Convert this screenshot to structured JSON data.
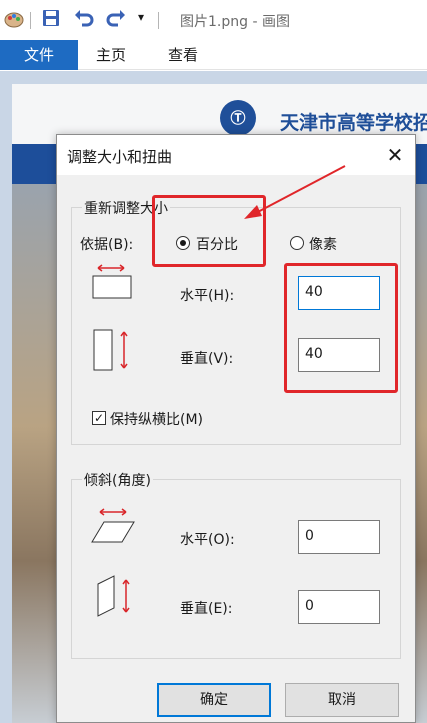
{
  "window": {
    "title": "图片1.png - 画图"
  },
  "ribbon": {
    "file_tab": "文件",
    "tabs": [
      "主页",
      "查看"
    ]
  },
  "background": {
    "header_text": "天津市高等学校招"
  },
  "dialog": {
    "title": "调整大小和扭曲",
    "resize": {
      "group_title": "重新调整大小",
      "by_label": "依据(B):",
      "options": [
        "百分比",
        "像素"
      ],
      "selected_option": "百分比",
      "horizontal_label": "水平(H):",
      "horizontal_value": "40",
      "vertical_label": "垂直(V):",
      "vertical_value": "40",
      "keep_ratio_label": "保持纵横比(M)",
      "keep_ratio_checked": true
    },
    "skew": {
      "group_title": "倾斜(角度)",
      "horizontal_label": "水平(O):",
      "horizontal_value": "0",
      "vertical_label": "垂直(E):",
      "vertical_value": "0"
    },
    "buttons": {
      "ok": "确定",
      "cancel": "取消"
    }
  },
  "colors": {
    "accent": "#1e6bc2",
    "highlight": "#e0262a"
  }
}
